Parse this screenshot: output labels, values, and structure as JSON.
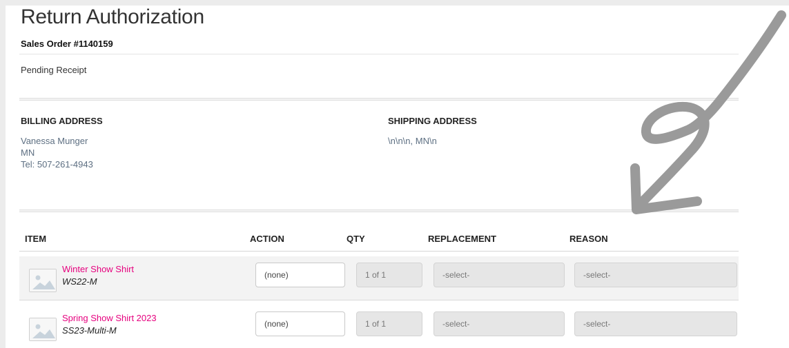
{
  "page": {
    "title": "Return Authorization",
    "order_label": "Sales Order #1140159",
    "status": "Pending Receipt"
  },
  "billing": {
    "heading": "BILLING ADDRESS",
    "lines": [
      "Vanessa Munger",
      "MN",
      "Tel: 507-261-4943"
    ]
  },
  "shipping": {
    "heading": "SHIPPING ADDRESS",
    "lines": [
      "\\n\\n\\n, MN\\n"
    ]
  },
  "table": {
    "headers": [
      "ITEM",
      "ACTION",
      "QTY",
      "REPLACEMENT",
      "REASON"
    ],
    "rows": [
      {
        "name": "Winter Show Shirt",
        "sku": "WS22-M",
        "action": "(none)",
        "qty": "1 of 1",
        "replacement": "-select-",
        "reason": "-select-"
      },
      {
        "name": "Spring Show Shirt 2023",
        "sku": "SS23-Multi-M",
        "action": "(none)",
        "qty": "1 of 1",
        "replacement": "-select-",
        "reason": "-select-"
      }
    ]
  },
  "icons": {
    "thumbnail": "image-placeholder-icon",
    "annotation": "hand-drawn-arrow"
  },
  "colors": {
    "link": "#e6007e",
    "address_text": "#5d6f82",
    "arrow": "#9a9a9a"
  }
}
